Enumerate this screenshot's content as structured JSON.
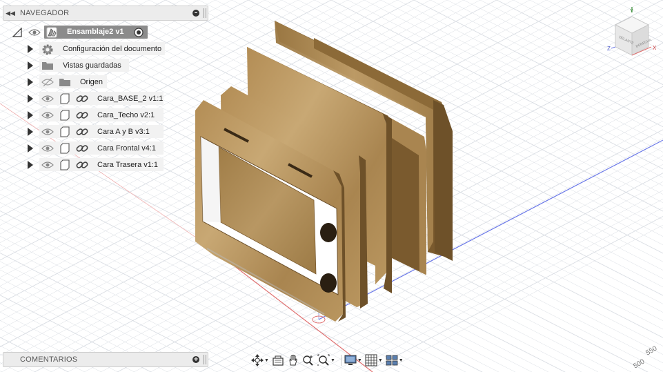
{
  "navigator": {
    "title": "NAVEGADOR",
    "root": {
      "label": "Ensamblaje2 v1"
    },
    "items": [
      {
        "label": "Configuración del documento",
        "icon": "gear-icon"
      },
      {
        "label": "Vistas guardadas",
        "icon": "folder-icon"
      },
      {
        "label": "Origen",
        "icon": "folder-icon",
        "visibility": "hidden"
      },
      {
        "label": "Cara_BASE_2 v1:1",
        "icon": "component-icon"
      },
      {
        "label": "Cara_Techo v2:1",
        "icon": "component-icon"
      },
      {
        "label": "Cara A y B v3:1",
        "icon": "component-icon"
      },
      {
        "label": "Cara Frontal v4:1",
        "icon": "component-icon"
      },
      {
        "label": "Cara Trasera v1:1",
        "icon": "component-icon"
      }
    ]
  },
  "comments": {
    "title": "COMENTARIOS"
  },
  "viewcube": {
    "face_front": "DELANTE",
    "face_right": "DERECHA",
    "axis_x": "X",
    "axis_y": "Y",
    "axis_z": "Z"
  },
  "grid_labels": {
    "label_550": "550",
    "label_500": "500"
  },
  "toolbar": {
    "tools": [
      "move-tool",
      "capture-position",
      "pan-hand",
      "zoom",
      "fit-zoom",
      "display-settings",
      "grid-settings",
      "viewports"
    ]
  },
  "colors": {
    "wood_light": "#c4a26e",
    "wood_dark": "#8a6a3c",
    "wood_edge": "#6b4f2a",
    "grid_line": "#d9dde3",
    "axis_red": "#e06060",
    "axis_blue": "#6a78e8",
    "root_bg": "#8b8b8b"
  }
}
